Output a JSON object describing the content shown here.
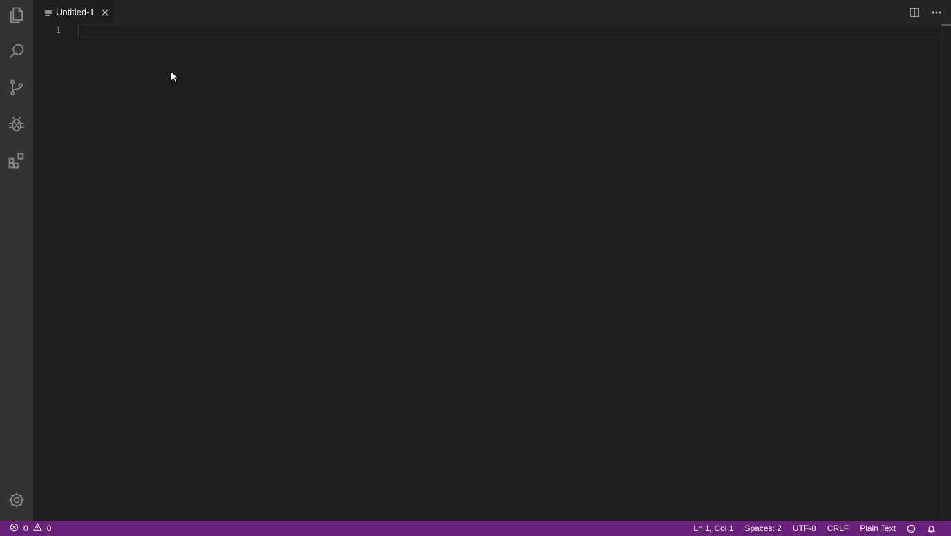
{
  "activity_bar": {
    "items": [
      {
        "name": "explorer",
        "icon": "files-icon"
      },
      {
        "name": "search",
        "icon": "search-icon"
      },
      {
        "name": "source-control",
        "icon": "source-control-icon"
      },
      {
        "name": "debug",
        "icon": "debug-icon"
      },
      {
        "name": "extensions",
        "icon": "extensions-icon"
      }
    ],
    "manage_icon": "gear-icon"
  },
  "tabs": [
    {
      "label": "Untitled-1",
      "icon": "file-lines-icon",
      "active": true
    }
  ],
  "editor": {
    "lines": [
      {
        "number": "1",
        "text": ""
      }
    ]
  },
  "editor_actions": [
    {
      "icon": "split-editor-icon"
    },
    {
      "icon": "more-icon"
    }
  ],
  "status_bar": {
    "background": "#68217a",
    "errors": "0",
    "warnings": "0",
    "position": "Ln 1, Col 1",
    "indentation": "Spaces: 2",
    "encoding": "UTF-8",
    "eol": "CRLF",
    "language": "Plain Text",
    "feedback_icon": "smiley-icon",
    "notifications_icon": "bell-icon"
  }
}
